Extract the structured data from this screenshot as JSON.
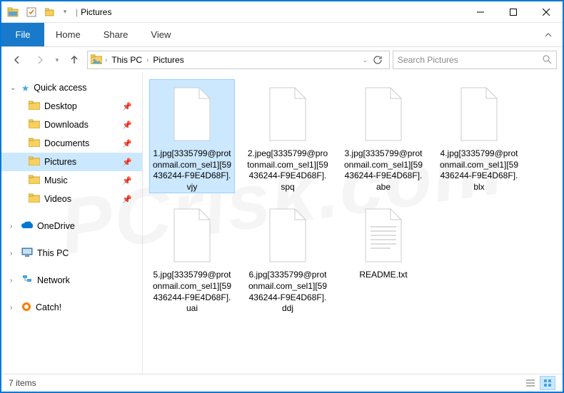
{
  "window": {
    "title": "Pictures"
  },
  "ribbon": {
    "file": "File",
    "tabs": [
      "Home",
      "Share",
      "View"
    ]
  },
  "breadcrumbs": [
    "This PC",
    "Pictures"
  ],
  "search": {
    "placeholder": "Search Pictures"
  },
  "sidebar": {
    "quick_access": "Quick access",
    "quick_items": [
      {
        "label": "Desktop",
        "icon": "desktop"
      },
      {
        "label": "Downloads",
        "icon": "downloads"
      },
      {
        "label": "Documents",
        "icon": "documents"
      },
      {
        "label": "Pictures",
        "icon": "pictures",
        "selected": true
      },
      {
        "label": "Music",
        "icon": "music"
      },
      {
        "label": "Videos",
        "icon": "videos"
      }
    ],
    "onedrive": "OneDrive",
    "thispc": "This PC",
    "network": "Network",
    "catch": "Catch!"
  },
  "files": [
    {
      "name": "1.jpg[3335799@protonmail.com_sel1][59436244-F9E4D68F].vjy",
      "type": "blank",
      "selected": true
    },
    {
      "name": "2.jpeg[3335799@protonmail.com_sel1][59436244-F9E4D68F].spq",
      "type": "blank"
    },
    {
      "name": "3.jpg[3335799@protonmail.com_sel1][59436244-F9E4D68F].abe",
      "type": "blank"
    },
    {
      "name": "4.jpg[3335799@protonmail.com_sel1][59436244-F9E4D68F].blx",
      "type": "blank"
    },
    {
      "name": "5.jpg[3335799@protonmail.com_sel1][59436244-F9E4D68F].uai",
      "type": "blank"
    },
    {
      "name": "6.jpg[3335799@protonmail.com_sel1][59436244-F9E4D68F].ddj",
      "type": "blank"
    },
    {
      "name": "README.txt",
      "type": "text"
    }
  ],
  "status": {
    "count": "7 items"
  }
}
